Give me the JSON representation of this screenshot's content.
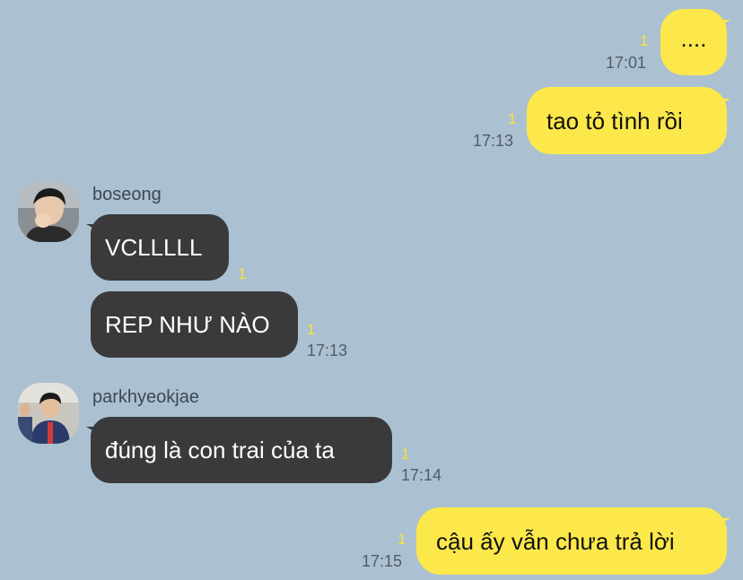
{
  "messages": [
    {
      "text": "....",
      "time": "17:01",
      "unread": "1",
      "side": "me"
    },
    {
      "text": "tao tỏ tình rồi",
      "time": "17:13",
      "unread": "1",
      "side": "me"
    },
    {
      "sender": "boseong",
      "text": "VCLLLLL",
      "time": "",
      "unread": "1",
      "side": "them"
    },
    {
      "text": "REP NHƯ NÀO",
      "time": "17:13",
      "unread": "1",
      "side": "them"
    },
    {
      "sender": "parkhyeokjae",
      "text": "đúng là con trai của ta",
      "time": "17:14",
      "unread": "1",
      "side": "them"
    },
    {
      "text": "cậu ấy vẫn chưa trả lời",
      "time": "17:15",
      "unread": "1",
      "side": "me"
    }
  ],
  "colors": {
    "background": "#abc1d1",
    "my_bubble": "#fce84a",
    "their_bubble": "#3a3a3c",
    "unread_count": "#f7e533",
    "timestamp": "#525c66"
  }
}
